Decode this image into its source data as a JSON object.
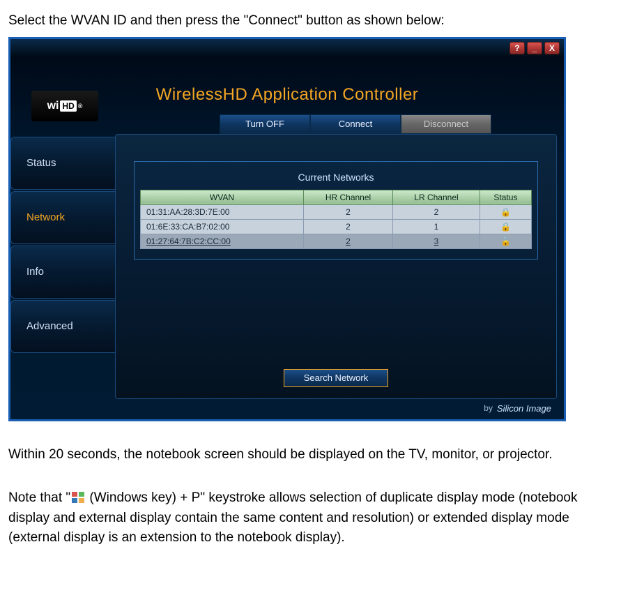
{
  "doc": {
    "intro": "Select the WVAN ID and then press the \"Connect\" button as shown below:",
    "after1": "Within 20 seconds, the notebook screen should be displayed on the TV, monitor, or projector.",
    "note_prefix": "Note that \"",
    "note_suffix": " (Windows key) + P\" keystroke allows selection of duplicate display mode (notebook display and external display contain the same content and resolution) or extended display mode (external display is an extension to the notebook display)."
  },
  "app": {
    "title": "WirelessHD Application Controller",
    "logo_text_main": "wi",
    "logo_text_hd": "HD",
    "titlebar": {
      "help": "?",
      "minimize": "_",
      "close": "X"
    },
    "buttons": {
      "turn_off": "Turn OFF",
      "connect": "Connect",
      "disconnect": "Disconnect",
      "search": "Search Network"
    },
    "sidebar": [
      {
        "label": "Status",
        "active": false
      },
      {
        "label": "Network",
        "active": true
      },
      {
        "label": "Info",
        "active": false
      },
      {
        "label": "Advanced",
        "active": false
      }
    ],
    "networks_title": "Current Networks",
    "columns": {
      "wvan": "WVAN",
      "hr": "HR Channel",
      "lr": "LR Channel",
      "status": "Status"
    },
    "rows": [
      {
        "wvan": "01:31:AA:28:3D:7E:00",
        "hr": "2",
        "lr": "2",
        "locked": true,
        "selected": false
      },
      {
        "wvan": "01:6E:33:CA:B7:02:00",
        "hr": "2",
        "lr": "1",
        "locked": true,
        "selected": false
      },
      {
        "wvan": "01:27:64:7B:C2:CC:00",
        "hr": "2",
        "lr": "3",
        "locked": true,
        "selected": true
      }
    ],
    "footer_by": "by",
    "footer_brand": "Silicon Image"
  }
}
